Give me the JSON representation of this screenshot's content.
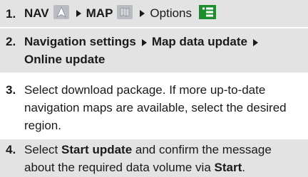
{
  "steps": [
    {
      "number": "1.",
      "nav": "NAV",
      "nav_icon": "navigation-arrow-icon",
      "map": "MAP",
      "map_icon": "map-icon",
      "options": "Options",
      "options_icon": "menu-list-icon"
    },
    {
      "number": "2.",
      "text_a": "Navigation settings",
      "text_b": "Map data update",
      "text_c": "Online update"
    },
    {
      "number": "3.",
      "text": "Select download package. If more up-to-date navigation maps are available, select the desired region."
    },
    {
      "number": "4.",
      "text_a": "Select ",
      "bold_a": "Start update",
      "text_b": " and confirm the message about the required data volume via ",
      "bold_b": "Start",
      "text_c": "."
    }
  ],
  "colors": {
    "shaded_row": "#e3e3e3",
    "text": "#1a1a1a",
    "options_icon_accent": "#1c8f2c"
  }
}
